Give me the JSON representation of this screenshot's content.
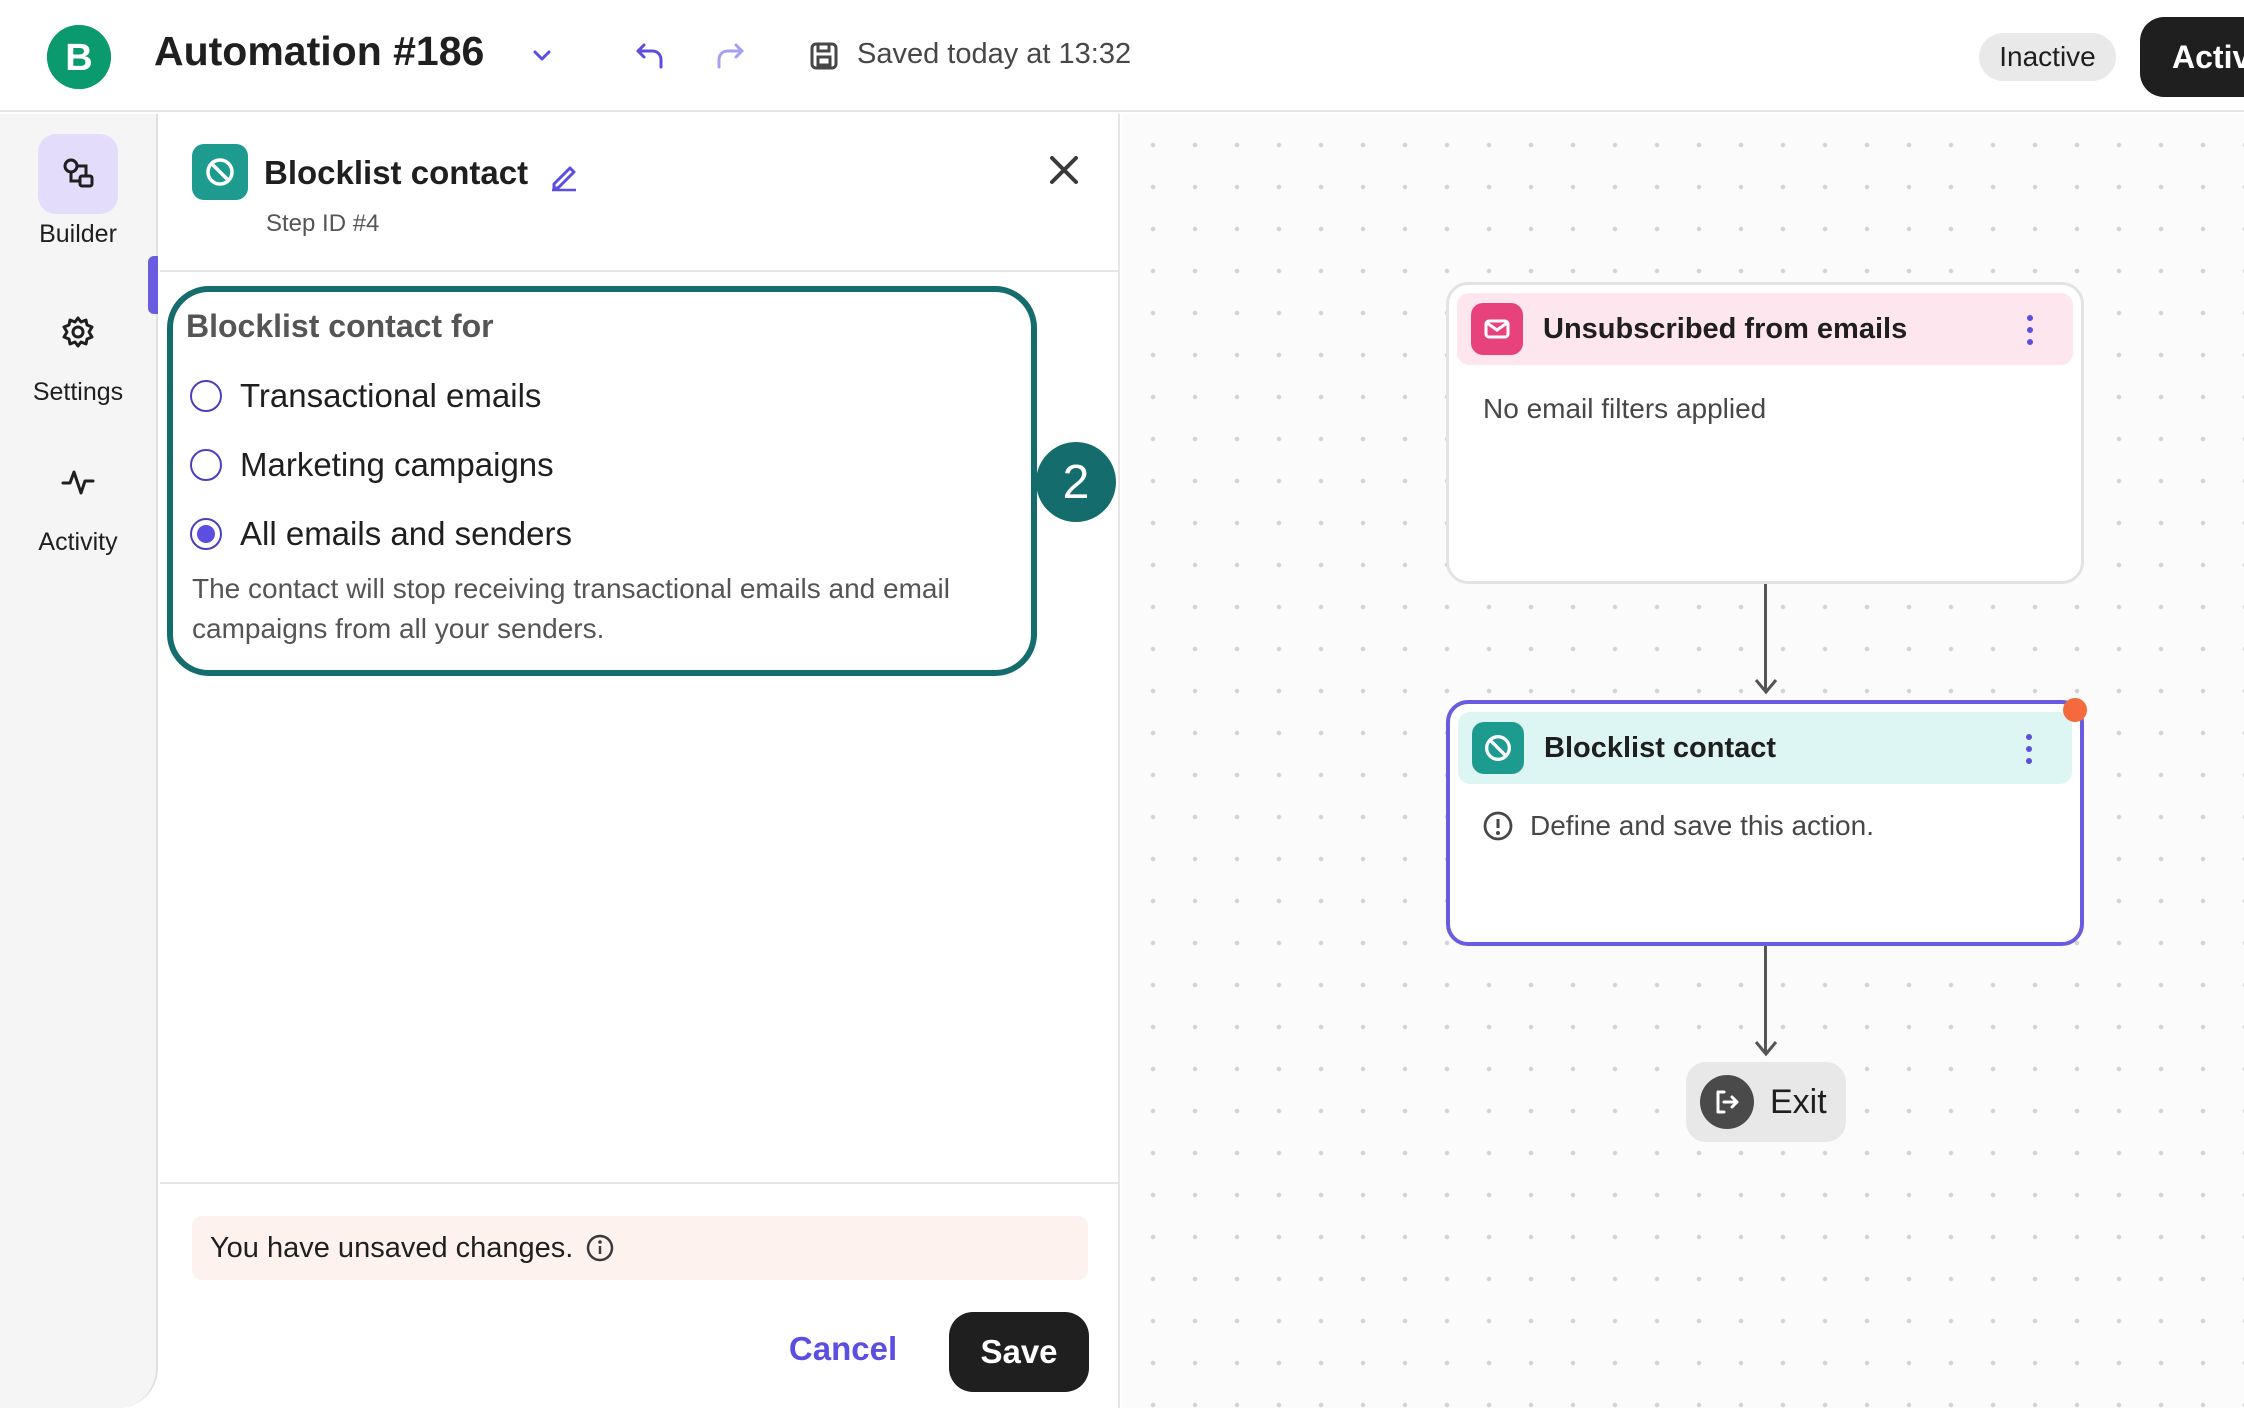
{
  "header": {
    "logo_letter": "B",
    "title": "Automation #186",
    "saved_status": "Saved today at 13:32",
    "status_badge": "Inactive",
    "activate_label": "Activate"
  },
  "rail": {
    "items": [
      {
        "label": "Builder",
        "icon": "builder-icon",
        "active": true
      },
      {
        "label": "Settings",
        "icon": "gear-icon",
        "active": false
      },
      {
        "label": "Activity",
        "icon": "activity-icon",
        "active": false
      }
    ]
  },
  "panel": {
    "title": "Blocklist contact",
    "step_id": "Step ID #4",
    "section_heading": "Blocklist contact for",
    "options": [
      {
        "label": "Transactional emails",
        "selected": false
      },
      {
        "label": "Marketing campaigns",
        "selected": false
      },
      {
        "label": "All emails and senders",
        "selected": true
      }
    ],
    "help_text": "The contact will stop receiving transactional emails and email campaigns from all your senders.",
    "step_marker": "2",
    "unsaved_text": "You have unsaved changes.",
    "cancel_label": "Cancel",
    "save_label": "Save"
  },
  "canvas": {
    "trigger_node": {
      "title": "Unsubscribed from emails",
      "body": "No email filters applied"
    },
    "action_node": {
      "title": "Blocklist contact",
      "body": "Define and save this action."
    },
    "exit_label": "Exit"
  },
  "colors": {
    "brand_green": "#0b996e",
    "accent_purple": "#5b4ee0",
    "teal": "#1d9b8f",
    "highlight_teal": "#156c6c",
    "pink": "#e8427c",
    "warning_dot": "#f46a3c"
  }
}
